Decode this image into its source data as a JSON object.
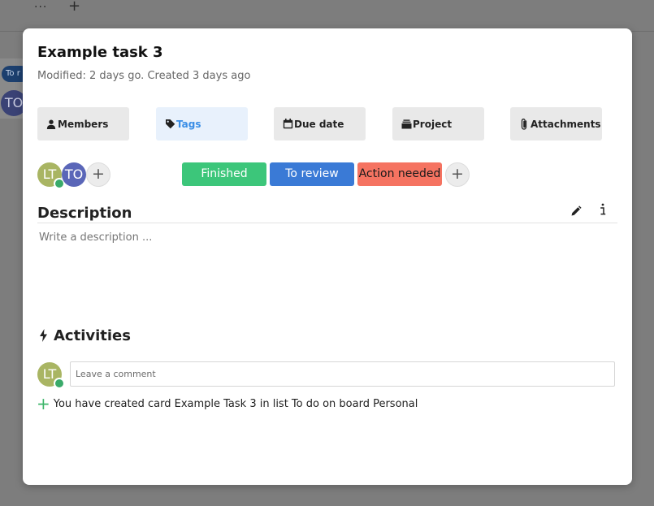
{
  "background": {
    "toolbar_dots": "···",
    "toolbar_plus": "+",
    "tag_text": "To r",
    "avatar_initials": "TO"
  },
  "modal": {
    "title": "Example task 3",
    "meta": "Modified: 2 days go. Created 3 days ago",
    "actions": [
      {
        "label": "Members",
        "icon": "person-icon"
      },
      {
        "label": "Tags",
        "icon": "tag-icon",
        "active": true
      },
      {
        "label": "Due date",
        "icon": "calendar-icon"
      },
      {
        "label": "Project",
        "icon": "project-icon"
      },
      {
        "label": "Attachments",
        "icon": "paperclip-icon"
      }
    ],
    "members": [
      {
        "initials": "LT",
        "color": "#a9b563",
        "online": true
      },
      {
        "initials": "TO",
        "color": "#5a66b8",
        "online": false
      }
    ],
    "add_symbol": "+",
    "tags": [
      {
        "label": "Finished",
        "color": "#3cc67a",
        "text_color": "#ffffff"
      },
      {
        "label": "To review",
        "color": "#3a7ad6",
        "text_color": "#ffffff"
      },
      {
        "label": "Action needed",
        "color": "#f57361",
        "text_color": "#1a1a1a"
      }
    ],
    "description": {
      "title": "Description",
      "placeholder": "Write a description ...",
      "edit_icon": "pencil-icon",
      "info_icon": "info-icon"
    },
    "activities": {
      "title": "Activities",
      "icon": "bolt-icon",
      "comment_placeholder": "Leave a comment",
      "current_user": {
        "initials": "LT",
        "color": "#a9b563",
        "online": true
      },
      "entries": [
        {
          "icon": "plus-icon",
          "text": "You have created card Example Task 3 in list To do on board Personal"
        }
      ]
    }
  }
}
